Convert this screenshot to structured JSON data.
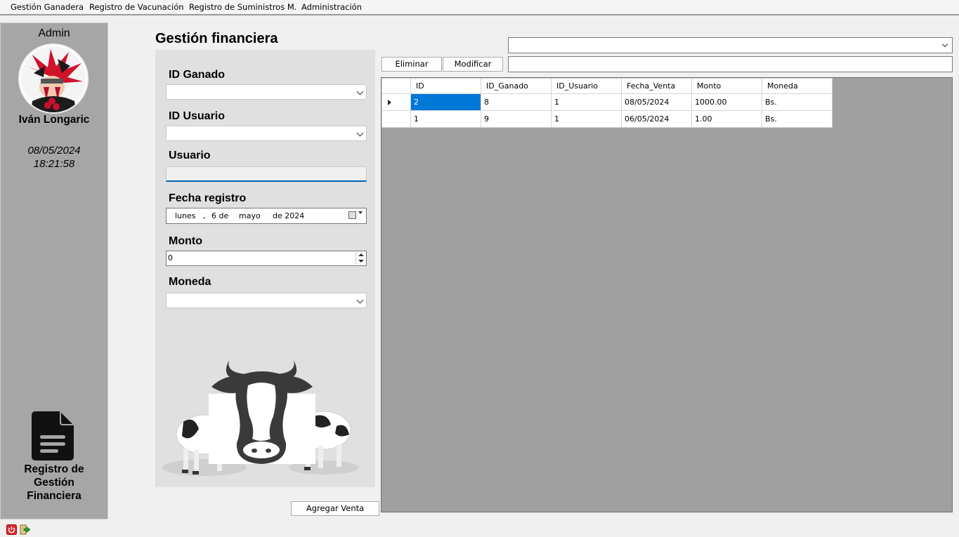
{
  "menu": {
    "items": [
      "Gestión Ganadera",
      "Registro de Vacunación",
      "Registro de Suministros M.",
      "Administración"
    ]
  },
  "sidebar": {
    "role": "Admin",
    "user_name": "Iván Longaric",
    "date": "08/05/2024",
    "time": "18:21:58",
    "section_line1": "Registro de",
    "section_line2": "Gestión",
    "section_line3": "Financiera",
    "icon": "document-icon"
  },
  "page": {
    "title": "Gestión financiera"
  },
  "form": {
    "id_ganado_label": "ID Ganado",
    "id_ganado_value": "",
    "id_usuario_label": "ID Usuario",
    "id_usuario_value": "",
    "usuario_label": "Usuario",
    "usuario_value": "",
    "fecha_label": "Fecha registro",
    "fecha": {
      "weekday": "lunes",
      "sep": ",",
      "day": "6 de",
      "month": "mayo",
      "year": "de 2024"
    },
    "monto_label": "Monto",
    "monto_value": "0",
    "moneda_label": "Moneda",
    "moneda_value": ""
  },
  "buttons": {
    "eliminar": "Eliminar",
    "modificar": "Modificar",
    "agregar": "Agregar Venta"
  },
  "filter": {
    "combo_value": "",
    "search_value": ""
  },
  "table": {
    "columns": [
      "ID",
      "ID_Ganado",
      "ID_Usuario",
      "Fecha_Venta",
      "Monto",
      "Moneda"
    ],
    "rows": [
      [
        "2",
        "8",
        "1",
        "08/05/2024",
        "1000.00",
        "Bs."
      ],
      [
        "1",
        "9",
        "1",
        "06/05/2024",
        "1.00",
        "Bs."
      ]
    ],
    "selected_row": 0
  },
  "colors": {
    "sidebar_bg": "#a6a6a6",
    "panel_bg": "#e0e0e0",
    "grid_bg": "#a0a0a0",
    "selection": "#0078d7"
  }
}
